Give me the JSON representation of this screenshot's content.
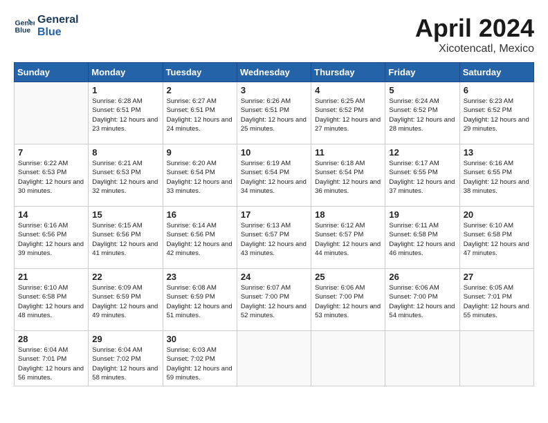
{
  "header": {
    "logo_line1": "General",
    "logo_line2": "Blue",
    "month_title": "April 2024",
    "location": "Xicotencatl, Mexico"
  },
  "weekdays": [
    "Sunday",
    "Monday",
    "Tuesday",
    "Wednesday",
    "Thursday",
    "Friday",
    "Saturday"
  ],
  "weeks": [
    [
      {
        "day": "",
        "sunrise": "",
        "sunset": "",
        "daylight": ""
      },
      {
        "day": "1",
        "sunrise": "Sunrise: 6:28 AM",
        "sunset": "Sunset: 6:51 PM",
        "daylight": "Daylight: 12 hours and 23 minutes."
      },
      {
        "day": "2",
        "sunrise": "Sunrise: 6:27 AM",
        "sunset": "Sunset: 6:51 PM",
        "daylight": "Daylight: 12 hours and 24 minutes."
      },
      {
        "day": "3",
        "sunrise": "Sunrise: 6:26 AM",
        "sunset": "Sunset: 6:51 PM",
        "daylight": "Daylight: 12 hours and 25 minutes."
      },
      {
        "day": "4",
        "sunrise": "Sunrise: 6:25 AM",
        "sunset": "Sunset: 6:52 PM",
        "daylight": "Daylight: 12 hours and 27 minutes."
      },
      {
        "day": "5",
        "sunrise": "Sunrise: 6:24 AM",
        "sunset": "Sunset: 6:52 PM",
        "daylight": "Daylight: 12 hours and 28 minutes."
      },
      {
        "day": "6",
        "sunrise": "Sunrise: 6:23 AM",
        "sunset": "Sunset: 6:52 PM",
        "daylight": "Daylight: 12 hours and 29 minutes."
      }
    ],
    [
      {
        "day": "7",
        "sunrise": "Sunrise: 6:22 AM",
        "sunset": "Sunset: 6:53 PM",
        "daylight": "Daylight: 12 hours and 30 minutes."
      },
      {
        "day": "8",
        "sunrise": "Sunrise: 6:21 AM",
        "sunset": "Sunset: 6:53 PM",
        "daylight": "Daylight: 12 hours and 32 minutes."
      },
      {
        "day": "9",
        "sunrise": "Sunrise: 6:20 AM",
        "sunset": "Sunset: 6:54 PM",
        "daylight": "Daylight: 12 hours and 33 minutes."
      },
      {
        "day": "10",
        "sunrise": "Sunrise: 6:19 AM",
        "sunset": "Sunset: 6:54 PM",
        "daylight": "Daylight: 12 hours and 34 minutes."
      },
      {
        "day": "11",
        "sunrise": "Sunrise: 6:18 AM",
        "sunset": "Sunset: 6:54 PM",
        "daylight": "Daylight: 12 hours and 36 minutes."
      },
      {
        "day": "12",
        "sunrise": "Sunrise: 6:17 AM",
        "sunset": "Sunset: 6:55 PM",
        "daylight": "Daylight: 12 hours and 37 minutes."
      },
      {
        "day": "13",
        "sunrise": "Sunrise: 6:16 AM",
        "sunset": "Sunset: 6:55 PM",
        "daylight": "Daylight: 12 hours and 38 minutes."
      }
    ],
    [
      {
        "day": "14",
        "sunrise": "Sunrise: 6:16 AM",
        "sunset": "Sunset: 6:56 PM",
        "daylight": "Daylight: 12 hours and 39 minutes."
      },
      {
        "day": "15",
        "sunrise": "Sunrise: 6:15 AM",
        "sunset": "Sunset: 6:56 PM",
        "daylight": "Daylight: 12 hours and 41 minutes."
      },
      {
        "day": "16",
        "sunrise": "Sunrise: 6:14 AM",
        "sunset": "Sunset: 6:56 PM",
        "daylight": "Daylight: 12 hours and 42 minutes."
      },
      {
        "day": "17",
        "sunrise": "Sunrise: 6:13 AM",
        "sunset": "Sunset: 6:57 PM",
        "daylight": "Daylight: 12 hours and 43 minutes."
      },
      {
        "day": "18",
        "sunrise": "Sunrise: 6:12 AM",
        "sunset": "Sunset: 6:57 PM",
        "daylight": "Daylight: 12 hours and 44 minutes."
      },
      {
        "day": "19",
        "sunrise": "Sunrise: 6:11 AM",
        "sunset": "Sunset: 6:58 PM",
        "daylight": "Daylight: 12 hours and 46 minutes."
      },
      {
        "day": "20",
        "sunrise": "Sunrise: 6:10 AM",
        "sunset": "Sunset: 6:58 PM",
        "daylight": "Daylight: 12 hours and 47 minutes."
      }
    ],
    [
      {
        "day": "21",
        "sunrise": "Sunrise: 6:10 AM",
        "sunset": "Sunset: 6:58 PM",
        "daylight": "Daylight: 12 hours and 48 minutes."
      },
      {
        "day": "22",
        "sunrise": "Sunrise: 6:09 AM",
        "sunset": "Sunset: 6:59 PM",
        "daylight": "Daylight: 12 hours and 49 minutes."
      },
      {
        "day": "23",
        "sunrise": "Sunrise: 6:08 AM",
        "sunset": "Sunset: 6:59 PM",
        "daylight": "Daylight: 12 hours and 51 minutes."
      },
      {
        "day": "24",
        "sunrise": "Sunrise: 6:07 AM",
        "sunset": "Sunset: 7:00 PM",
        "daylight": "Daylight: 12 hours and 52 minutes."
      },
      {
        "day": "25",
        "sunrise": "Sunrise: 6:06 AM",
        "sunset": "Sunset: 7:00 PM",
        "daylight": "Daylight: 12 hours and 53 minutes."
      },
      {
        "day": "26",
        "sunrise": "Sunrise: 6:06 AM",
        "sunset": "Sunset: 7:00 PM",
        "daylight": "Daylight: 12 hours and 54 minutes."
      },
      {
        "day": "27",
        "sunrise": "Sunrise: 6:05 AM",
        "sunset": "Sunset: 7:01 PM",
        "daylight": "Daylight: 12 hours and 55 minutes."
      }
    ],
    [
      {
        "day": "28",
        "sunrise": "Sunrise: 6:04 AM",
        "sunset": "Sunset: 7:01 PM",
        "daylight": "Daylight: 12 hours and 56 minutes."
      },
      {
        "day": "29",
        "sunrise": "Sunrise: 6:04 AM",
        "sunset": "Sunset: 7:02 PM",
        "daylight": "Daylight: 12 hours and 58 minutes."
      },
      {
        "day": "30",
        "sunrise": "Sunrise: 6:03 AM",
        "sunset": "Sunset: 7:02 PM",
        "daylight": "Daylight: 12 hours and 59 minutes."
      },
      {
        "day": "",
        "sunrise": "",
        "sunset": "",
        "daylight": ""
      },
      {
        "day": "",
        "sunrise": "",
        "sunset": "",
        "daylight": ""
      },
      {
        "day": "",
        "sunrise": "",
        "sunset": "",
        "daylight": ""
      },
      {
        "day": "",
        "sunrise": "",
        "sunset": "",
        "daylight": ""
      }
    ]
  ]
}
